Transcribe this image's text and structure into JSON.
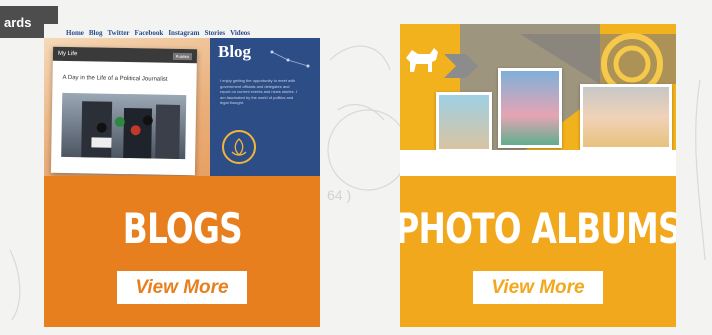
{
  "corner_tab": {
    "label": "ards"
  },
  "cards": [
    {
      "title": "BLOGS",
      "button_label": "View More",
      "preview": {
        "nav_items": [
          "Home",
          "Blog",
          "Twitter",
          "Facebook",
          "Instagram",
          "Stories",
          "Videos"
        ],
        "window_title": "My Life",
        "window_button": "Publish",
        "headline": "A Day in the Life of a Political Journalist",
        "blog_word": "Blog",
        "blog_desc": "I enjoy getting the opportunity to meet with government officials and delegates and report on current events and news stories. I am fascinated by the world of politics and legal thought."
      }
    },
    {
      "title": "PHOTO ALBUMS",
      "button_label": "View More"
    }
  ],
  "colors": {
    "blogs_accent": "#e77f1f",
    "photos_accent": "#f2a81c",
    "blog_panel": "#2d4d86"
  }
}
